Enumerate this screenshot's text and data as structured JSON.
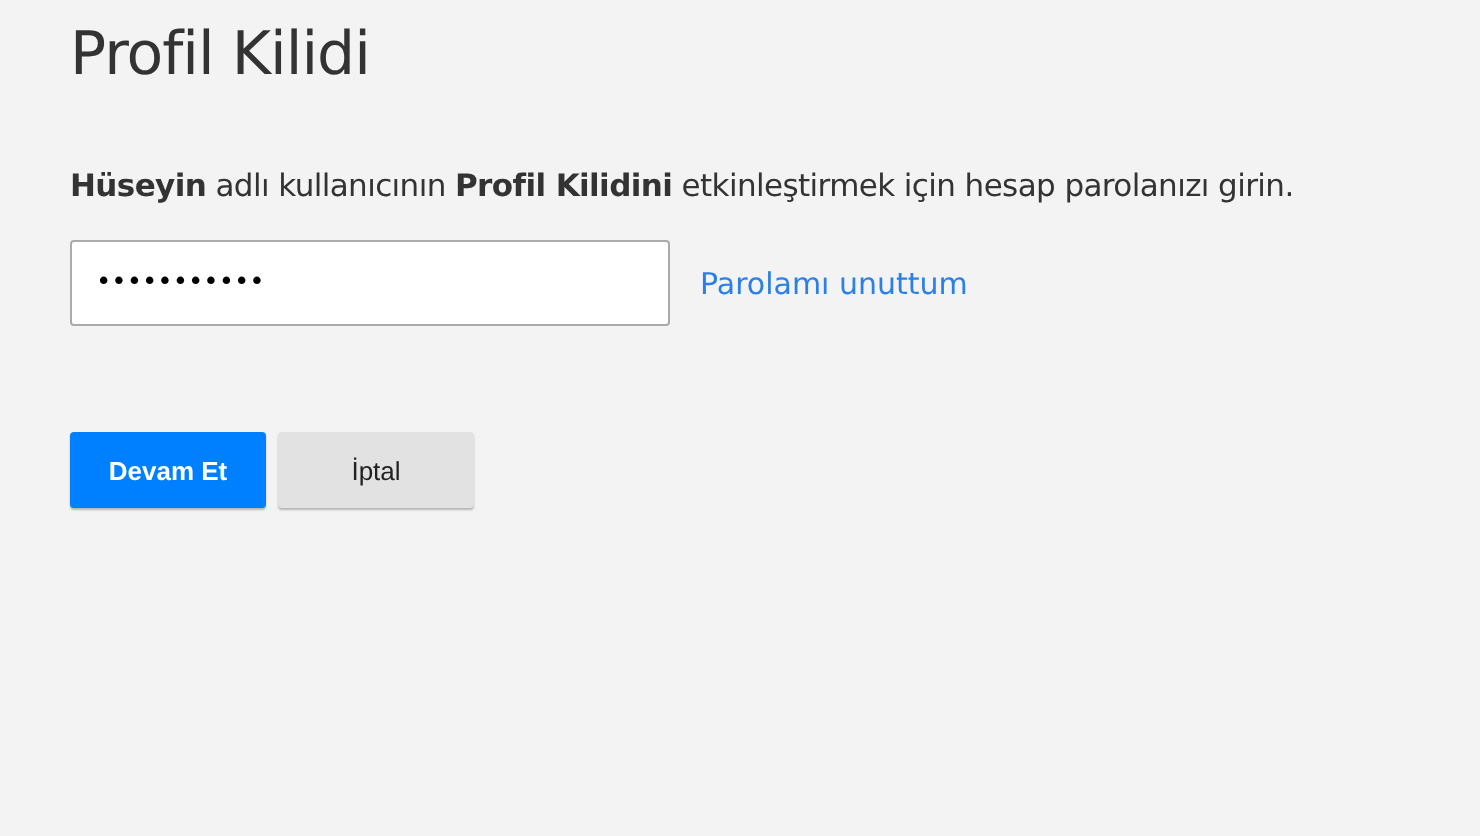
{
  "title": "Profil Kilidi",
  "instruction": "**Hüseyin** adlı kullanıcının **Profil Kilidini** etkinleştirmek için hesap parolanızı girin.",
  "password_field": {
    "value": "•••••••••••"
  },
  "forgot_link": "Parolamı unuttum",
  "buttons": [
    {
      "label": "Devam Et",
      "kind": "primary"
    },
    {
      "label": "İptal",
      "kind": "secondary"
    }
  ]
}
